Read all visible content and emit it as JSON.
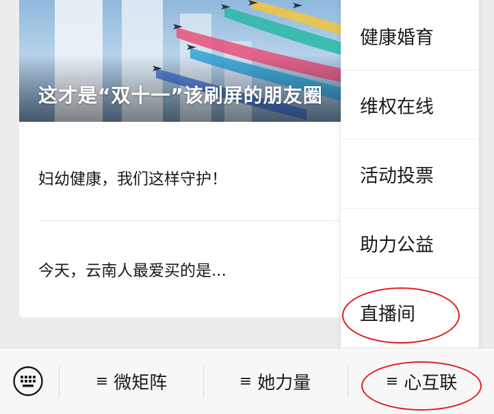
{
  "feed": {
    "banner_caption": "这才是“双十一”该刷屏的朋友圈",
    "articles": [
      {
        "title": "妇幼健康，我们这样守护！"
      },
      {
        "title": "今天，云南人最爱买的是..."
      }
    ]
  },
  "submenu": {
    "items": [
      {
        "label": "健康婚育"
      },
      {
        "label": "维权在线"
      },
      {
        "label": "活动投票"
      },
      {
        "label": "助力公益"
      },
      {
        "label": "直播间"
      }
    ]
  },
  "menubar": {
    "keyboard_icon": "keyboard-icon",
    "tabs": [
      {
        "icon": "≡",
        "label": "微矩阵"
      },
      {
        "icon": "≡",
        "label": "她力量"
      },
      {
        "icon": "≡",
        "label": "心互联"
      }
    ]
  },
  "colors": {
    "annotation": "#e01a1a",
    "background": "#ededed",
    "banner_sky": "#8fb8dc"
  }
}
